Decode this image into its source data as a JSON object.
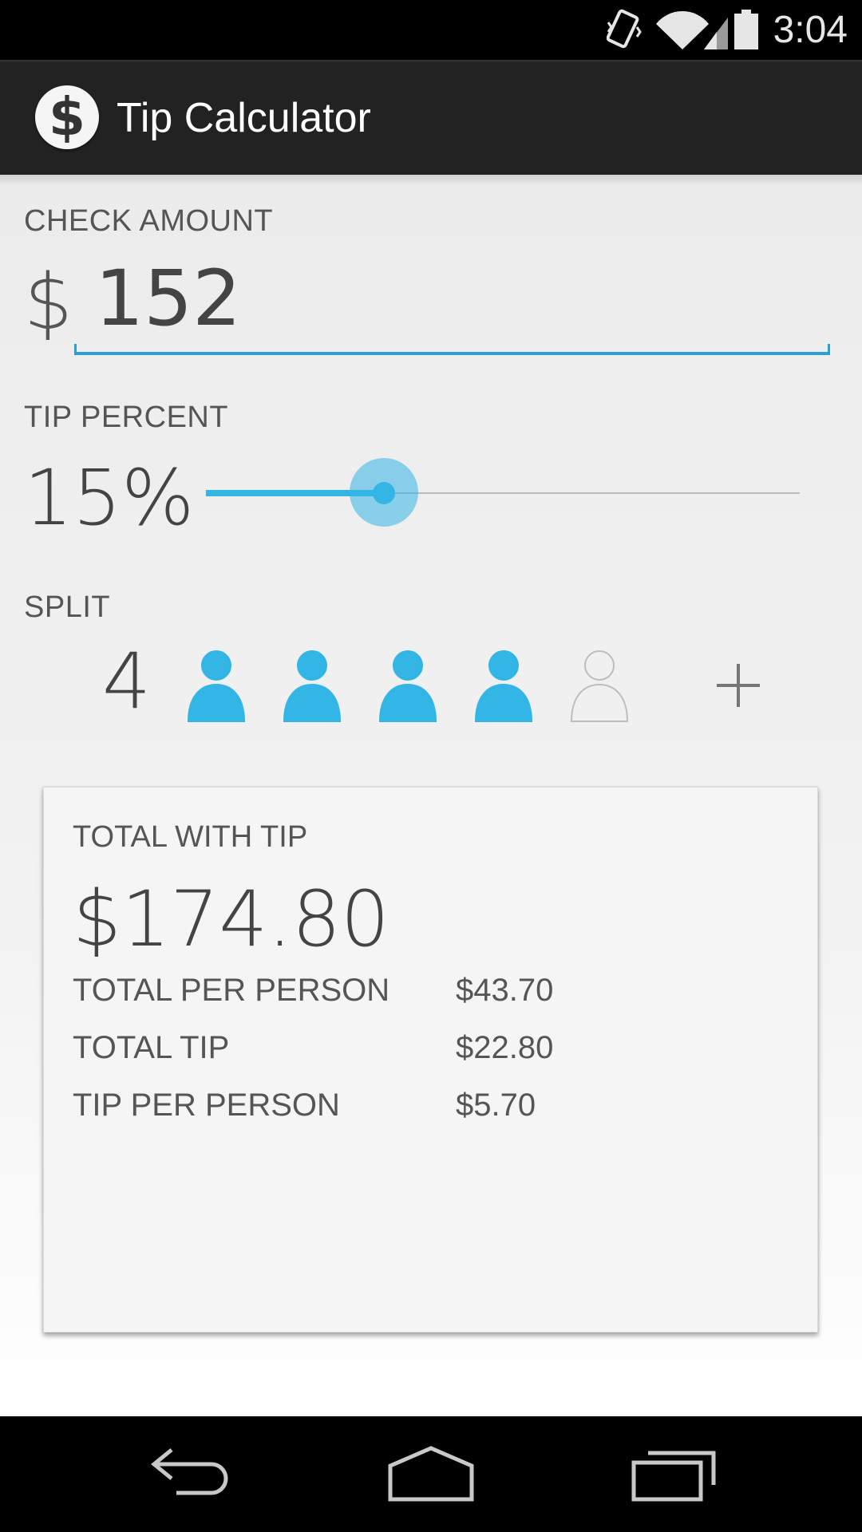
{
  "status_bar": {
    "time": "3:04",
    "icons": [
      "vibrate-icon",
      "wifi-icon",
      "cell-signal-icon",
      "battery-icon"
    ]
  },
  "app": {
    "title": "Tip Calculator",
    "icon": "dollar-icon",
    "icon_glyph": "$"
  },
  "check": {
    "label": "CHECK AMOUNT",
    "currency": "$",
    "value": "152"
  },
  "tip": {
    "label": "TIP PERCENT",
    "value": "15%",
    "slider_fraction": 0.3
  },
  "split": {
    "label": "SPLIT",
    "count": "4",
    "people_active": 4,
    "people_shown": 5,
    "add_icon": "plus-icon"
  },
  "results": {
    "total_label": "TOTAL WITH TIP",
    "total_value": "$174.80",
    "rows": [
      {
        "label": "TOTAL PER PERSON",
        "value": "$43.70"
      },
      {
        "label": "TOTAL TIP",
        "value": "$22.80"
      },
      {
        "label": "TIP PER PERSON",
        "value": "$5.70"
      }
    ]
  },
  "nav": {
    "back": "back-icon",
    "home": "home-icon",
    "recents": "recents-icon"
  },
  "colors": {
    "accent": "#33b5e5",
    "underline": "#2a9fd6",
    "action_bar": "#222222",
    "status_bar": "#000000"
  }
}
